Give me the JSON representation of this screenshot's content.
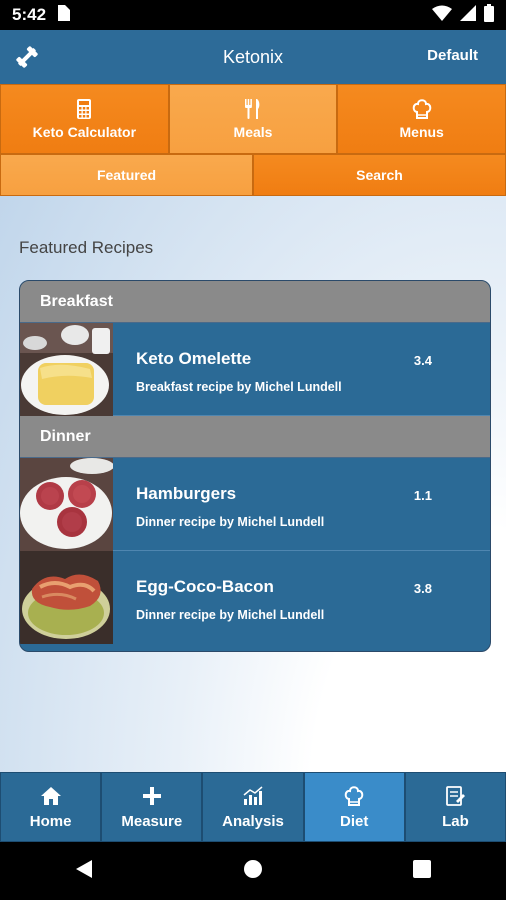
{
  "status_bar": {
    "time": "5:42"
  },
  "app_bar": {
    "title": "Ketonix",
    "profile": "Default"
  },
  "main_tabs": [
    {
      "label": "Keto Calculator",
      "icon": "calculator-icon"
    },
    {
      "label": "Meals",
      "icon": "fork-knife-icon"
    },
    {
      "label": "Menus",
      "icon": "chef-hat-icon"
    }
  ],
  "sub_tabs": [
    {
      "label": "Featured"
    },
    {
      "label": "Search"
    }
  ],
  "section_title": "Featured Recipes",
  "categories": [
    {
      "name": "Breakfast",
      "recipes": [
        {
          "name": "Keto Omelette",
          "desc": "Breakfast recipe by Michel Lundell",
          "score": "3.4"
        }
      ]
    },
    {
      "name": "Dinner",
      "recipes": [
        {
          "name": "Hamburgers",
          "desc": "Dinner recipe by Michel Lundell",
          "score": "1.1"
        },
        {
          "name": "Egg-Coco-Bacon",
          "desc": "Dinner recipe by Michel Lundell",
          "score": "3.8"
        }
      ]
    }
  ],
  "bottom_nav": [
    {
      "label": "Home",
      "icon": "home-icon"
    },
    {
      "label": "Measure",
      "icon": "plus-icon"
    },
    {
      "label": "Analysis",
      "icon": "chart-icon"
    },
    {
      "label": "Diet",
      "icon": "chef-hat-icon"
    },
    {
      "label": "Lab",
      "icon": "lab-icon"
    }
  ],
  "colors": {
    "primary": "#2b6a96",
    "accent": "#f58a1f",
    "active_nav": "#3a8cc9"
  }
}
